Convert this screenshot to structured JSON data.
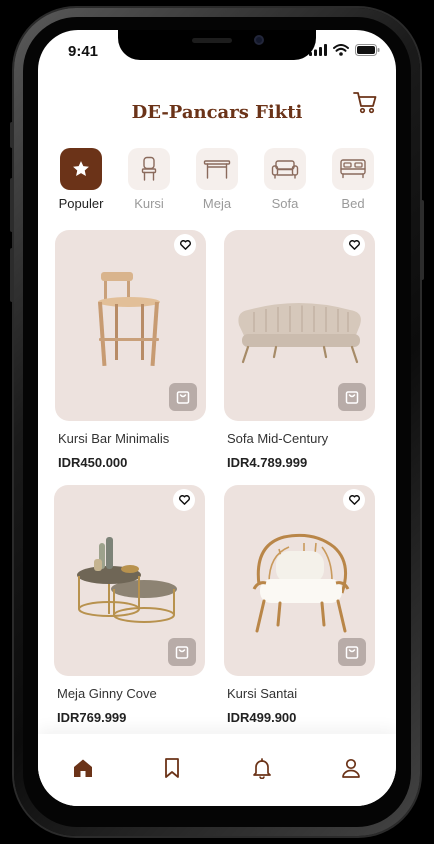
{
  "status_bar": {
    "time": "9:41"
  },
  "header": {
    "title": "DE-Pancars Fikti"
  },
  "categories": [
    {
      "label": "Populer",
      "icon": "star-icon",
      "active": true
    },
    {
      "label": "Kursi",
      "icon": "chair-icon",
      "active": false
    },
    {
      "label": "Meja",
      "icon": "table-icon",
      "active": false
    },
    {
      "label": "Sofa",
      "icon": "sofa-icon",
      "active": false
    },
    {
      "label": "Bed",
      "icon": "bed-icon",
      "active": false
    }
  ],
  "products": [
    {
      "name": "Kursi Bar Minimalis",
      "price": "IDR450.000"
    },
    {
      "name": "Sofa Mid-Century",
      "price": "IDR4.789.999"
    },
    {
      "name": "Meja Ginny Cove",
      "price": "IDR769.999"
    },
    {
      "name": "Kursi Santai",
      "price": "IDR499.900"
    }
  ],
  "bottom_nav": [
    {
      "icon": "home-icon",
      "active": true
    },
    {
      "icon": "bookmark-icon",
      "active": false
    },
    {
      "icon": "bell-icon",
      "active": false
    },
    {
      "icon": "profile-icon",
      "active": false
    }
  ],
  "colors": {
    "brand": "#6b3318",
    "card_bg": "#ede2de",
    "category_bg": "#f5efec",
    "bag_button": "#b8aca8"
  }
}
